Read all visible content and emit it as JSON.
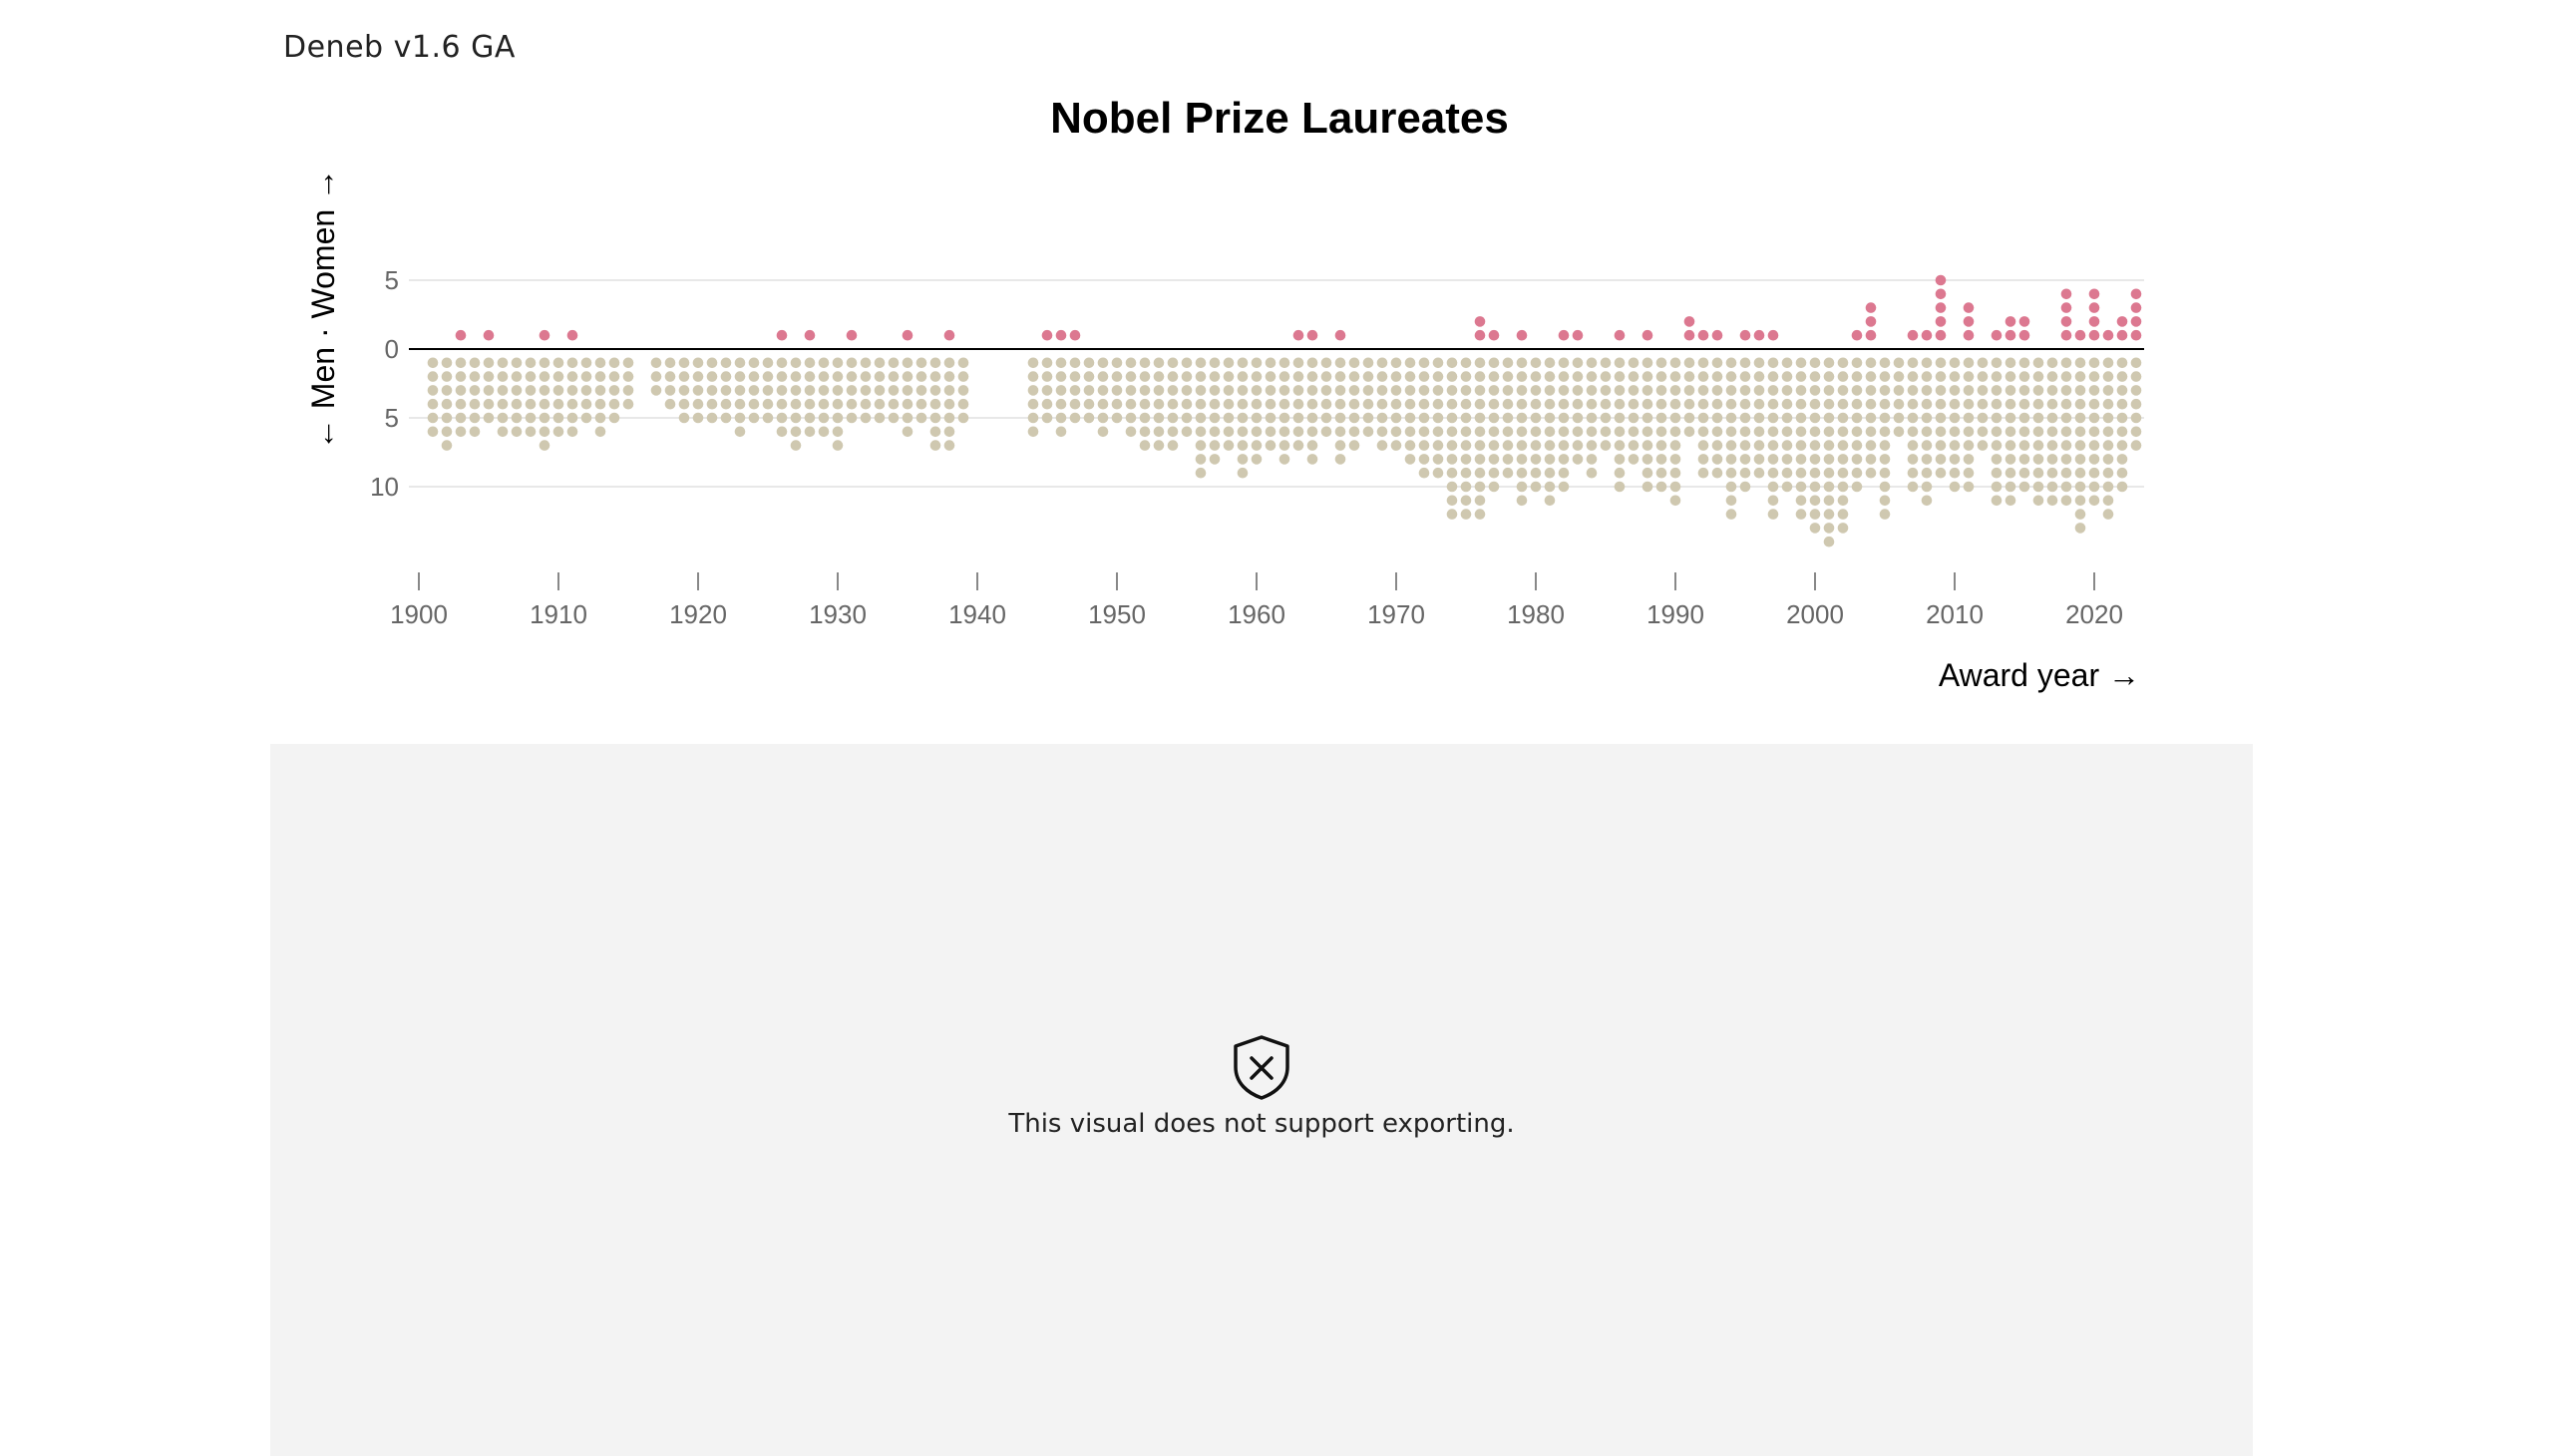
{
  "app": {
    "label": "Deneb v1.6 GA"
  },
  "export_notice": {
    "icon": "shield-x-icon",
    "message": "This visual does not support exporting."
  },
  "colors": {
    "women": "#dc7890",
    "men": "#cfc8b0",
    "gridline": "#e0e0e0",
    "zero_line": "#000000",
    "tick_label": "#666666",
    "panel_background": "#f3f3f3"
  },
  "chart_data": {
    "type": "scatter",
    "title": "Nobel Prize Laureates",
    "xlabel": "Award year →",
    "ylabel": "← Men · Women →",
    "x_ticks": [
      1900,
      1910,
      1920,
      1930,
      1940,
      1950,
      1960,
      1970,
      1980,
      1990,
      2000,
      2010,
      2020
    ],
    "y_ticks": [
      {
        "value": 5,
        "label": "5"
      },
      {
        "value": 0,
        "label": "0"
      },
      {
        "value": -5,
        "label": "5"
      },
      {
        "value": -10,
        "label": "10"
      }
    ],
    "xlim": [
      1900,
      2023
    ],
    "ylim": [
      -14,
      5
    ],
    "grid": true,
    "legend": "none",
    "series": [
      {
        "name": "Women",
        "years": [
          1903,
          1905,
          1909,
          1911,
          1926,
          1928,
          1931,
          1935,
          1938,
          1945,
          1946,
          1947,
          1963,
          1964,
          1966,
          1976,
          1977,
          1979,
          1982,
          1983,
          1986,
          1988,
          1991,
          1992,
          1993,
          1995,
          1996,
          1997,
          2003,
          2004,
          2007,
          2008,
          2009,
          2011,
          2013,
          2014,
          2015,
          2018,
          2019,
          2020,
          2021,
          2022,
          2023
        ],
        "counts": [
          1,
          1,
          1,
          1,
          1,
          1,
          1,
          1,
          1,
          1,
          1,
          1,
          1,
          1,
          1,
          2,
          1,
          1,
          1,
          1,
          1,
          1,
          2,
          1,
          1,
          1,
          1,
          1,
          1,
          3,
          1,
          1,
          5,
          3,
          1,
          2,
          2,
          4,
          1,
          4,
          1,
          2,
          4
        ]
      },
      {
        "name": "Men",
        "years": [
          1901,
          1902,
          1903,
          1904,
          1905,
          1906,
          1907,
          1908,
          1909,
          1910,
          1911,
          1912,
          1913,
          1914,
          1915,
          1917,
          1918,
          1919,
          1920,
          1921,
          1922,
          1923,
          1924,
          1925,
          1926,
          1927,
          1928,
          1929,
          1930,
          1931,
          1932,
          1933,
          1934,
          1935,
          1936,
          1937,
          1938,
          1939,
          1944,
          1945,
          1946,
          1947,
          1948,
          1949,
          1950,
          1951,
          1952,
          1953,
          1954,
          1955,
          1956,
          1957,
          1958,
          1959,
          1960,
          1961,
          1962,
          1963,
          1964,
          1965,
          1966,
          1967,
          1968,
          1969,
          1970,
          1971,
          1972,
          1973,
          1974,
          1975,
          1976,
          1977,
          1978,
          1979,
          1980,
          1981,
          1982,
          1983,
          1984,
          1985,
          1986,
          1987,
          1988,
          1989,
          1990,
          1991,
          1992,
          1993,
          1994,
          1995,
          1996,
          1997,
          1998,
          1999,
          2000,
          2001,
          2002,
          2003,
          2004,
          2005,
          2006,
          2007,
          2008,
          2009,
          2010,
          2011,
          2012,
          2013,
          2014,
          2015,
          2016,
          2017,
          2018,
          2019,
          2020,
          2021,
          2022,
          2023
        ],
        "counts": [
          6,
          7,
          6,
          6,
          5,
          6,
          6,
          6,
          7,
          6,
          6,
          5,
          6,
          5,
          4,
          3,
          4,
          5,
          5,
          5,
          5,
          6,
          5,
          5,
          6,
          7,
          6,
          6,
          7,
          5,
          5,
          5,
          5,
          6,
          5,
          7,
          7,
          5,
          6,
          5,
          6,
          5,
          5,
          6,
          5,
          6,
          7,
          7,
          7,
          6,
          9,
          8,
          7,
          9,
          8,
          7,
          8,
          7,
          8,
          6,
          8,
          7,
          6,
          7,
          7,
          8,
          9,
          9,
          12,
          12,
          12,
          10,
          9,
          11,
          10,
          11,
          10,
          8,
          9,
          7,
          10,
          8,
          10,
          10,
          11,
          6,
          9,
          9,
          12,
          10,
          9,
          12,
          10,
          12,
          13,
          14,
          13,
          10,
          9,
          12,
          6,
          10,
          11,
          9,
          10,
          10,
          7,
          11,
          11,
          10,
          11,
          11,
          11,
          13,
          11,
          12,
          10,
          7
        ]
      }
    ]
  }
}
